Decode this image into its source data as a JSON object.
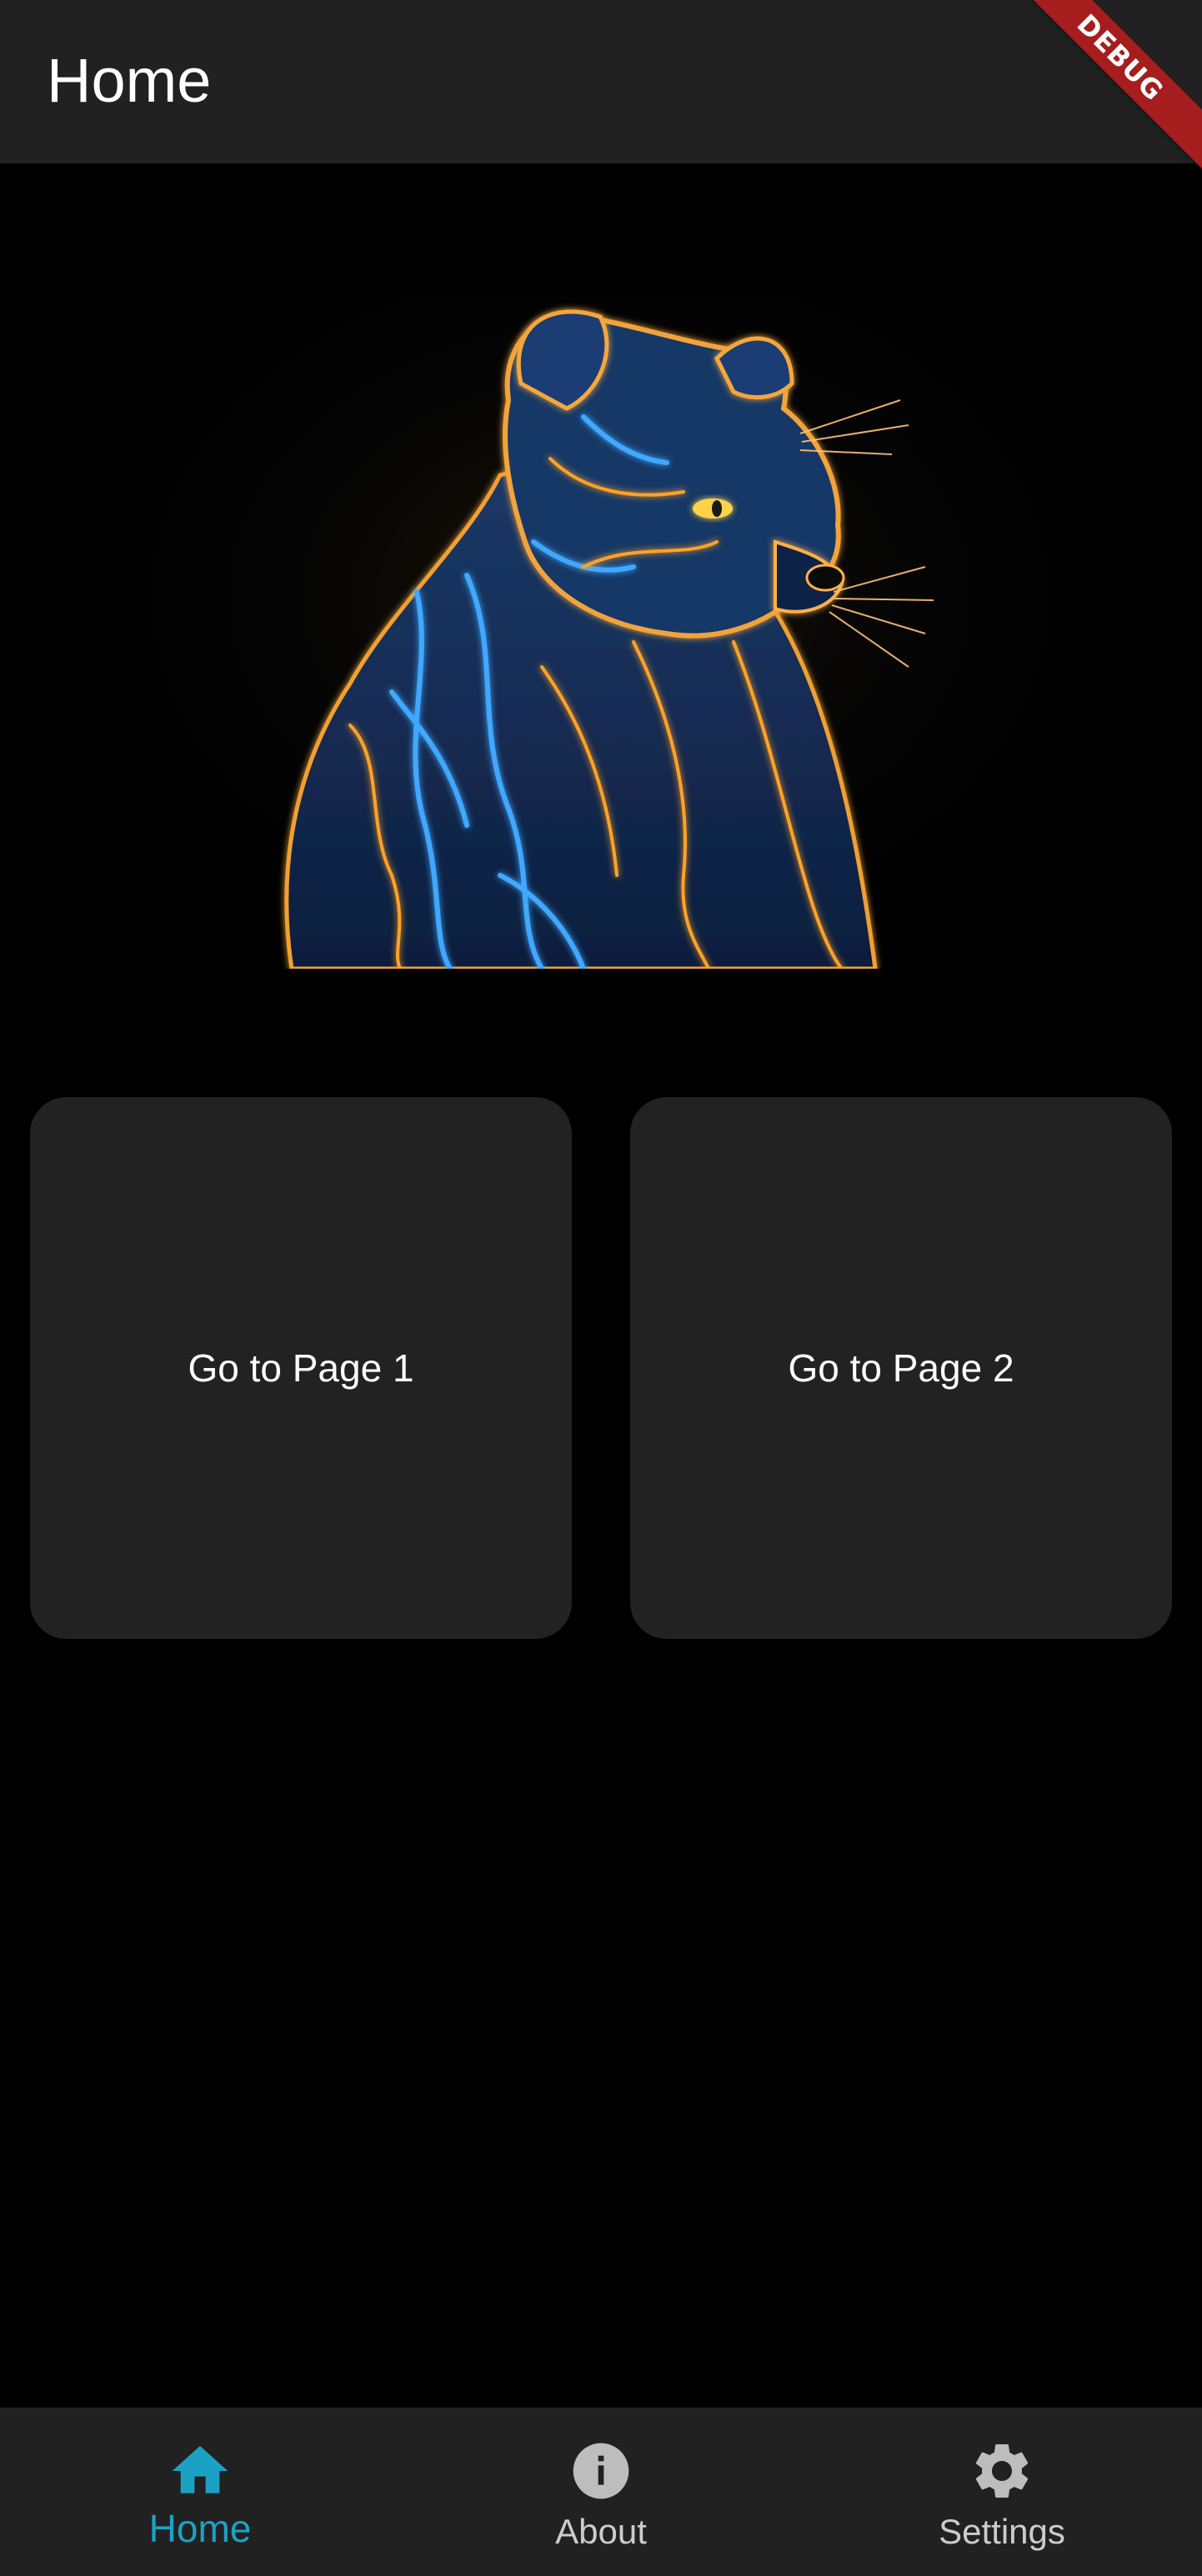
{
  "app_bar": {
    "title": "Home",
    "debug_label": "DEBUG"
  },
  "main": {
    "buttons": [
      {
        "label": "Go to Page 1"
      },
      {
        "label": "Go to Page 2"
      }
    ]
  },
  "bottom_nav": {
    "selected_index": 0,
    "items": [
      {
        "label": "Home",
        "icon": "home-icon",
        "color": "#1ba1c4"
      },
      {
        "label": "About",
        "icon": "info-icon",
        "color": "#cccccc"
      },
      {
        "label": "Settings",
        "icon": "gear-icon",
        "color": "#cccccc"
      }
    ]
  },
  "colors": {
    "accent": "#1ba1c4",
    "app_bar_bg": "#212121",
    "card_bg": "#222222",
    "debug_banner": "#a51d1d"
  }
}
